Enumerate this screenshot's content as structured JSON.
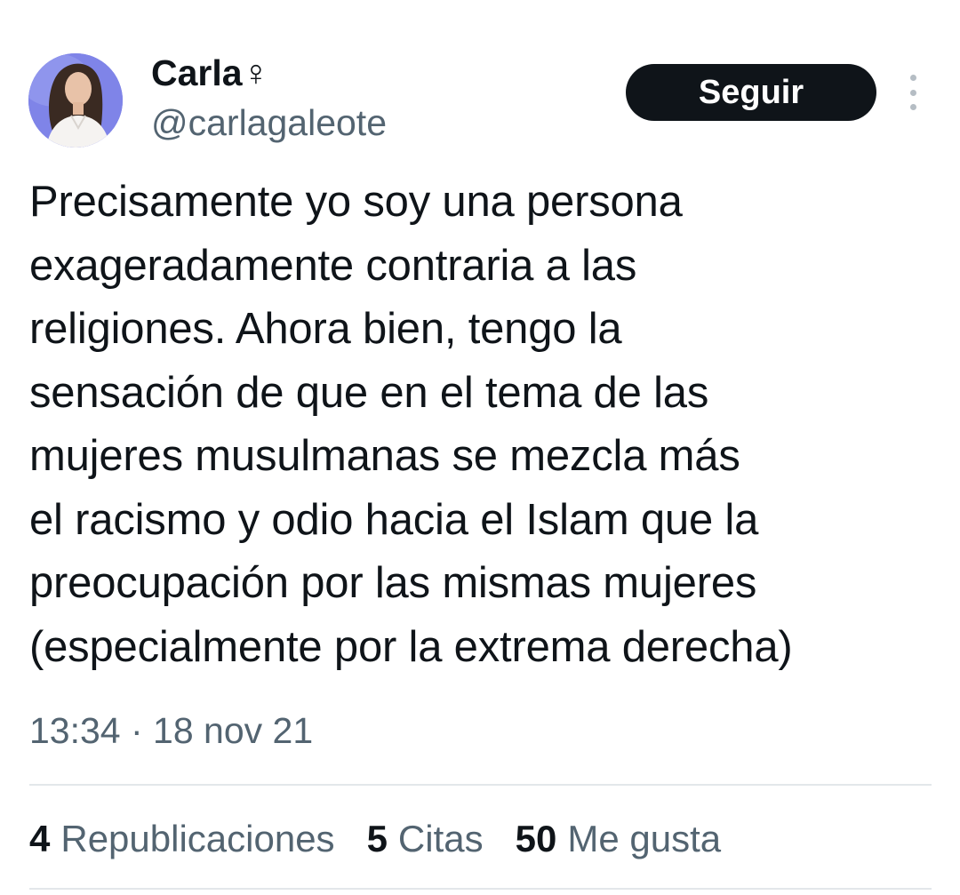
{
  "author": {
    "display_name": "Carla♀",
    "handle": "@carlagaleote"
  },
  "actions": {
    "follow_label": "Seguir"
  },
  "tweet": {
    "text_lines": [
      "Precisamente yo soy una persona",
      "exageradamente contraria a las",
      "religiones. Ahora bien, tengo la",
      "sensación de que en el tema de las",
      "mujeres musulmanas se mezcla más",
      "el racismo y odio hacia el Islam que la",
      "preocupación por las mismas mujeres",
      "(especialmente por la extrema derecha)"
    ],
    "timestamp": "13:34 · 18 nov 21"
  },
  "stats": [
    {
      "count": "4",
      "label": "Republicaciones"
    },
    {
      "count": "5",
      "label": "Citas"
    },
    {
      "count": "50",
      "label": "Me gusta"
    }
  ],
  "colors": {
    "text_primary": "#0f1419",
    "text_secondary": "#536471",
    "button_bg": "#0f1419",
    "divider": "#e3e7ea",
    "avatar_bg": "#7f84e8"
  },
  "icons": {
    "more": "more-vertical-icon"
  }
}
